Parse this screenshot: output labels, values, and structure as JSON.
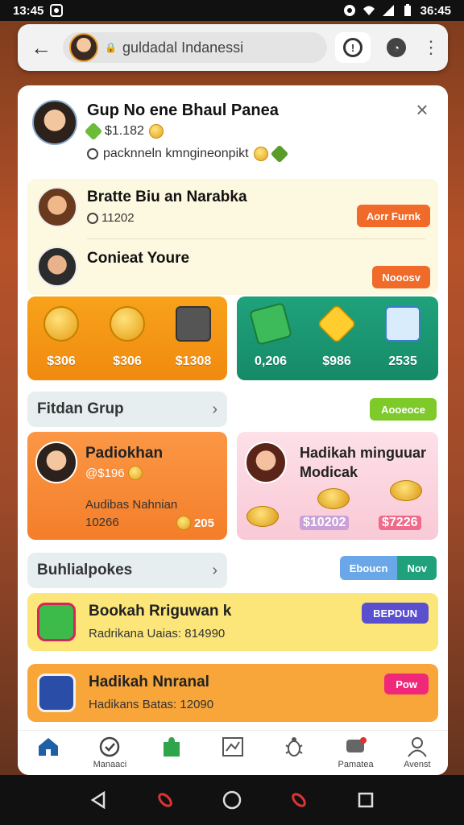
{
  "status_bar": {
    "time": "13:45",
    "right_time": "36:45"
  },
  "browser": {
    "url": "guldadal Indanessi"
  },
  "profile": {
    "name": "Gup No ene Bhaul Panea",
    "coins": "$1.182",
    "description": "packnneln kmngineonpikt"
  },
  "friends": [
    {
      "name": "Bratte Biu an Narabka",
      "sub": "11202",
      "button": "Aorr Furnk"
    },
    {
      "name": "Conieat Youre",
      "sub": "",
      "button": "Nooosv"
    }
  ],
  "tiles": {
    "orange": [
      "$306",
      "$306",
      "$1308"
    ],
    "green": [
      "0,206",
      "$986",
      "2535"
    ]
  },
  "section1": {
    "title": "Fitdan Grup",
    "button": "Aooeoce"
  },
  "card_orange": {
    "title": "Padiokhan",
    "sub": "@$196",
    "note": "Audibas Nahnian",
    "note2": "10266",
    "bonus": "205"
  },
  "card_pink": {
    "title": "Hadikah minguuar Modicak",
    "val_left": "$10202",
    "val_right": "$7226"
  },
  "section2": {
    "title": "Buhlialpokes",
    "btn_a": "Eboucn",
    "btn_b": "Nov"
  },
  "list": [
    {
      "title": "Bookah Rriguwan k",
      "sub": "Radrikana Uaias: 814990",
      "button": "BEPDUN",
      "color": "#5a4fcf"
    },
    {
      "title": "Hadikah Nnranal",
      "sub": "Hadikans Batas: 12090",
      "button": "Pow",
      "color": "#f0287a"
    }
  ],
  "bottom_nav": [
    {
      "label": "",
      "icon": "home-icon"
    },
    {
      "label": "Manaaci",
      "icon": "heart-badge-icon"
    },
    {
      "label": "",
      "icon": "puzzle-icon"
    },
    {
      "label": "",
      "icon": "chart-icon"
    },
    {
      "label": "",
      "icon": "bug-icon"
    },
    {
      "label": "Pamatea",
      "icon": "chat-icon"
    },
    {
      "label": "Avenst",
      "icon": "user-icon"
    }
  ],
  "colors": {
    "orange_accent": "#f06a2a",
    "green_accent": "#1fa27b",
    "nav_blue": "#1e5fa8"
  }
}
